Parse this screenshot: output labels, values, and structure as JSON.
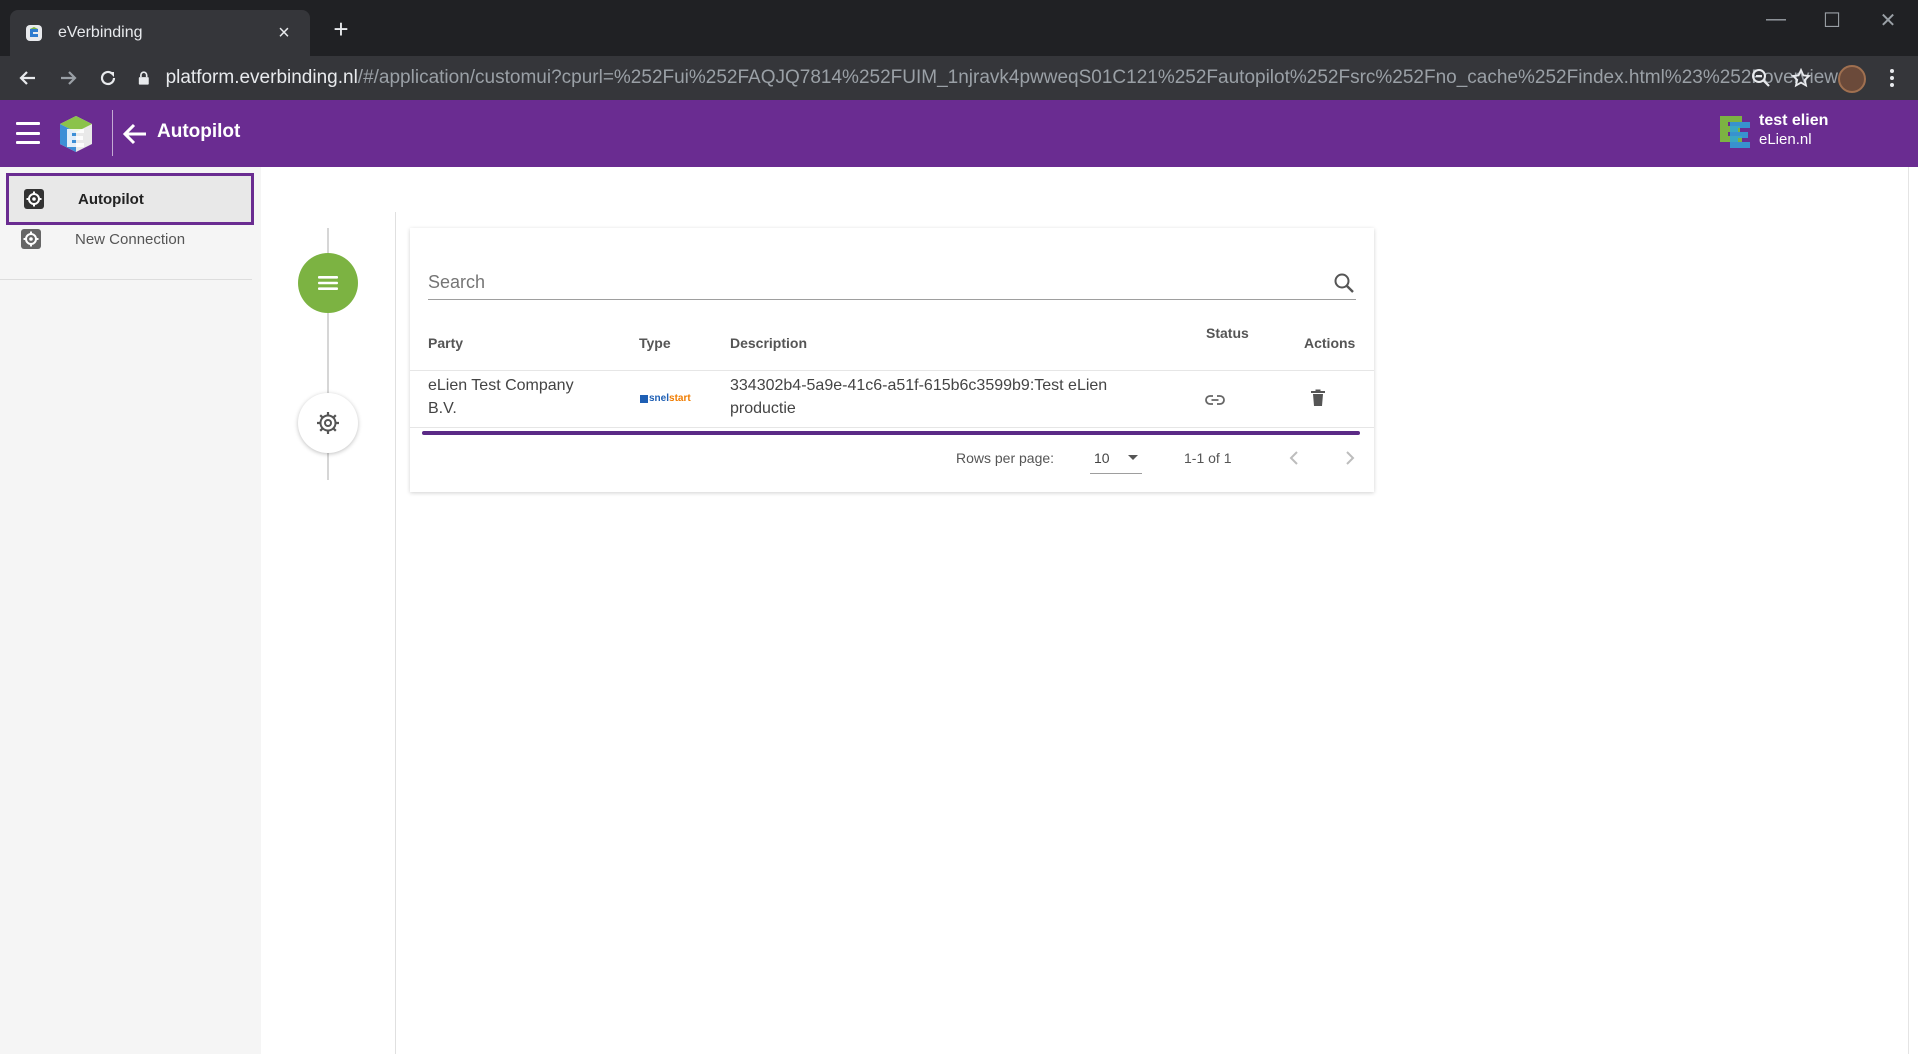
{
  "browser": {
    "tab_title": "eVerbinding",
    "tab_close": "×",
    "new_tab": "+",
    "url_host": "platform.everbinding.nl",
    "url_path": "/#/application/customui?cpurl=%252Fui%252FAQJQ7814%252FUIM_1njravk4pwweqS01C121%252Fautopilot%252Fsrc%252Fno_cache%252Findex.html%23%252Foverview",
    "win_minimize": "—",
    "win_maximize": "☐",
    "win_close": "✕"
  },
  "header": {
    "title": "Autopilot",
    "user_name": "test elien",
    "user_org": "eLien.nl",
    "bar_color": "#6a2c91"
  },
  "sidebar": {
    "items": [
      {
        "label": "Autopilot",
        "icon": "settings-box-icon",
        "active": true
      },
      {
        "label": "New Connection",
        "icon": "settings-box-icon",
        "active": false
      }
    ]
  },
  "stepper": {
    "steps": [
      {
        "icon": "list-icon",
        "color": "#7cb342"
      },
      {
        "icon": "gear-icon",
        "color": "#ffffff"
      }
    ]
  },
  "table": {
    "search_placeholder": "Search",
    "columns": [
      "Party",
      "Type",
      "Description",
      "Status",
      "Actions"
    ],
    "rows": [
      {
        "party_line1": "eLien Test Company",
        "party_line2": "B.V.",
        "type_logo": {
          "prefix": "snel",
          "suffix": "start"
        },
        "description_line1": "334302b4-5a9e-41c6-a51f-615b6c3599b9:Test eLien",
        "description_line2": "productie",
        "status_icon": "link-icon",
        "action_icon": "delete-icon"
      }
    ],
    "pagination": {
      "rows_per_page_label": "Rows per page:",
      "rows_per_page_value": "10",
      "range": "1-1 of 1"
    }
  }
}
